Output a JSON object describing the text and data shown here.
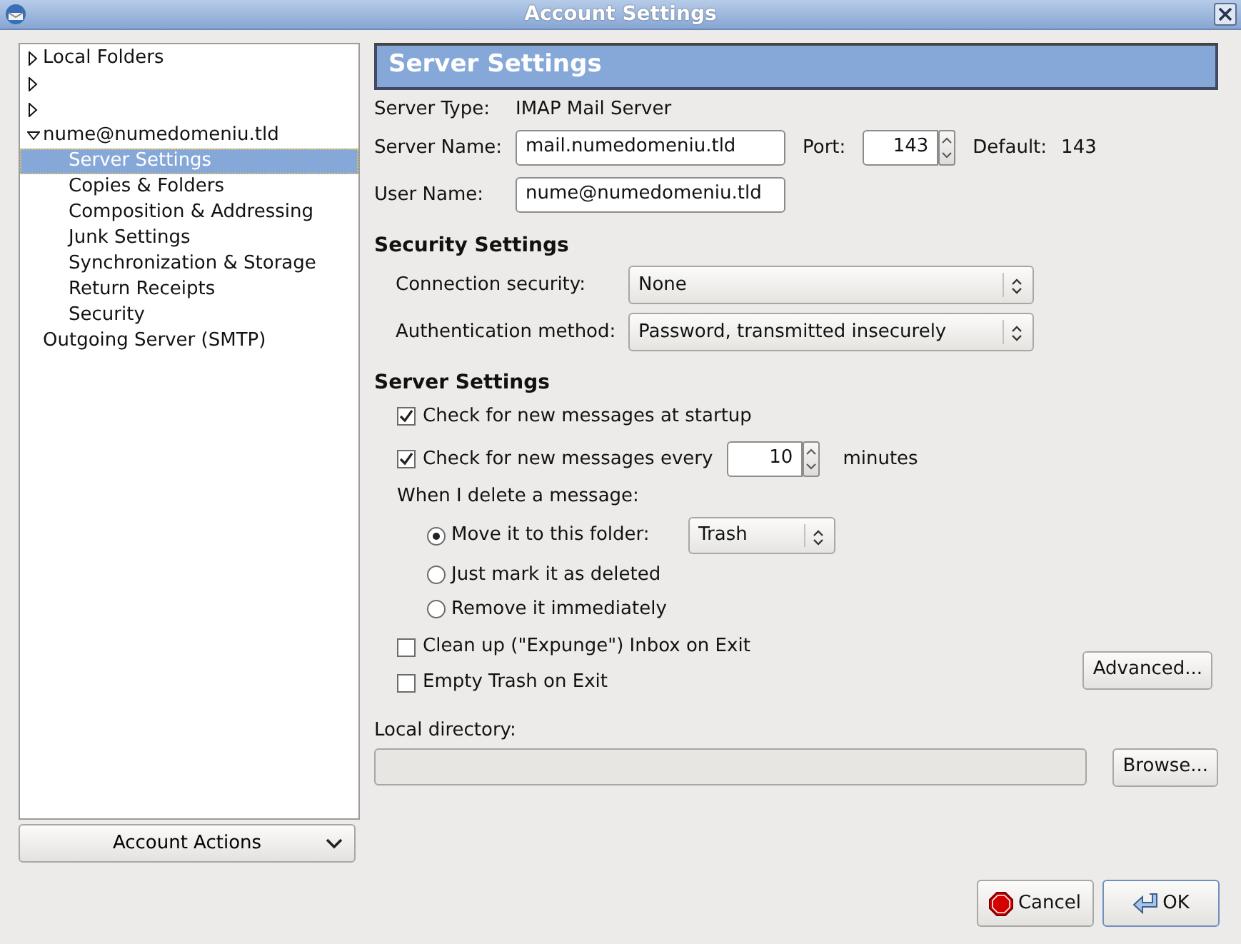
{
  "window": {
    "title": "Account Settings"
  },
  "account_tree": [
    {
      "label": "Local Folders",
      "expanded": false,
      "selected": false
    },
    {
      "expanded": false,
      "selected": false
    },
    {
      "expanded": false,
      "selected": false
    },
    {
      "label": "nume@numedomeniu.tld",
      "expanded": true,
      "selected": false,
      "children": [
        {
          "label": "Server Settings",
          "selected": true
        },
        {
          "label": "Copies & Folders",
          "selected": false
        },
        {
          "label": "Composition & Addressing",
          "selected": false
        },
        {
          "label": "Junk Settings",
          "selected": false
        },
        {
          "label": "Synchronization & Storage",
          "selected": false
        },
        {
          "label": "Return Receipts",
          "selected": false
        },
        {
          "label": "Security",
          "selected": false
        }
      ]
    },
    {
      "label": "Outgoing Server (SMTP)",
      "selected": false
    }
  ],
  "account_actions": {
    "label": "Account Actions"
  },
  "panel": {
    "title": "Server Settings",
    "server_type": {
      "label": "Server Type:",
      "value": "IMAP Mail Server"
    },
    "server_name": {
      "label": "Server Name:",
      "value": "mail.numedomeniu.tld"
    },
    "port": {
      "label": "Port:",
      "value": "143"
    },
    "default": {
      "label": "Default:",
      "value": "143"
    },
    "user_name": {
      "label": "User Name:",
      "value": "nume@numedomeniu.tld"
    }
  },
  "security": {
    "heading": "Security Settings",
    "fields": [
      {
        "label": "Connection security:",
        "value": "None"
      },
      {
        "label": "Authentication method:",
        "value": "Password, transmitted insecurely"
      }
    ]
  },
  "server": {
    "heading": "Server Settings",
    "check_startup": {
      "label": "Check for new messages at startup",
      "checked": true
    },
    "check_every": {
      "label": "Check for new messages every",
      "checked": true,
      "value": "10",
      "unit": "minutes"
    },
    "delete_label": "When I delete a message:",
    "delete_options": [
      {
        "label": "Move it to this folder:",
        "selected": true,
        "folder": "Trash"
      },
      {
        "label": "Just mark it as deleted",
        "selected": false
      },
      {
        "label": "Remove it immediately",
        "selected": false
      }
    ],
    "cleanup": {
      "label": "Clean up (\"Expunge\") Inbox on Exit",
      "checked": false
    },
    "empty_trash": {
      "label": "Empty Trash on Exit",
      "checked": false
    },
    "advanced": {
      "label": "Advanced..."
    }
  },
  "local_directory": {
    "label": "Local directory:",
    "disabled": true,
    "browse": {
      "label": "Browse..."
    }
  },
  "buttons": [
    {
      "label": "Cancel",
      "kind": "cancel"
    },
    {
      "label": "OK",
      "kind": "ok"
    }
  ]
}
